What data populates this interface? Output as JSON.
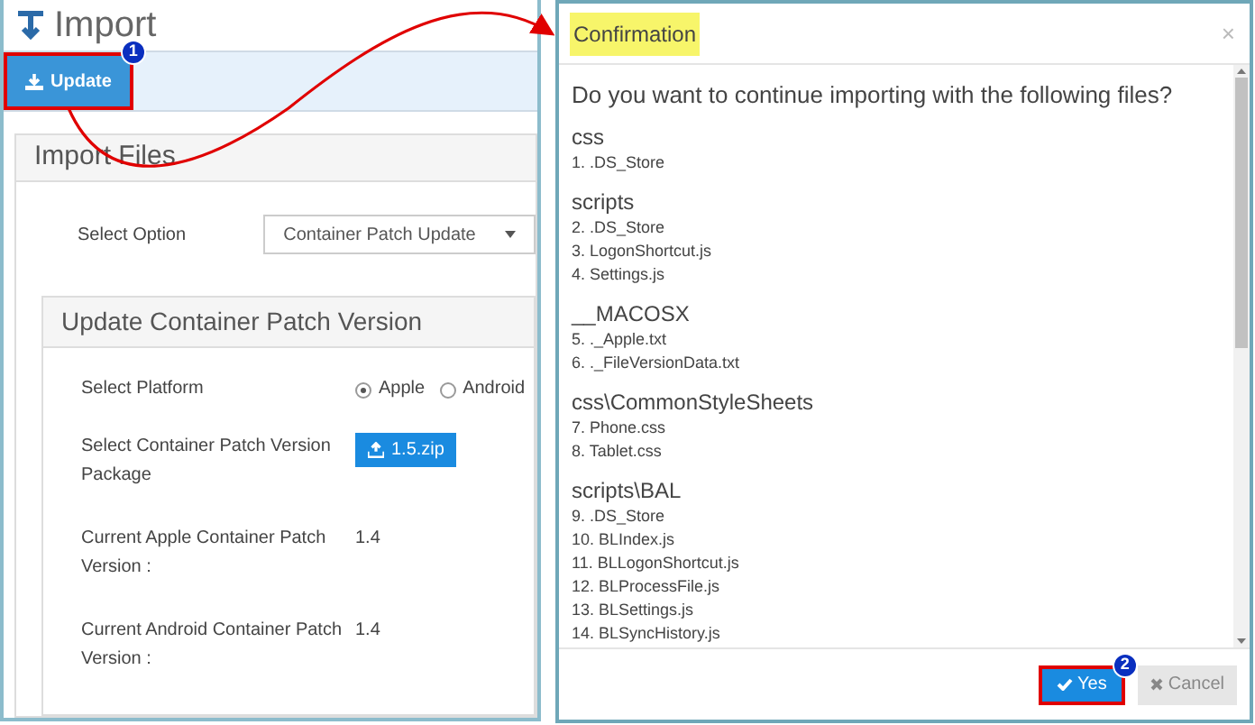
{
  "page": {
    "title": "Import"
  },
  "toolbar": {
    "update_button": "Update",
    "callout": "1"
  },
  "import_files": {
    "title": "Import Files",
    "select_option": {
      "label": "Select Option",
      "value": "Container Patch Update"
    },
    "update_panel": {
      "title": "Update Container Patch Version",
      "platform": {
        "label": "Select Platform",
        "options": [
          {
            "label": "Apple",
            "selected": true
          },
          {
            "label": "Android",
            "selected": false
          }
        ]
      },
      "package": {
        "label": "Select Container Patch Version Package",
        "button": "1.5.zip"
      },
      "versions": [
        {
          "label": "Current Apple Container Patch Version :",
          "value": "1.4"
        },
        {
          "label": "Current Android Container Patch Version :",
          "value": "1.4"
        }
      ]
    }
  },
  "dialog": {
    "title": "Confirmation",
    "close": "×",
    "question": "Do you want to continue importing with the following files?",
    "groups": [
      {
        "name": "css",
        "files": [
          "1. .DS_Store"
        ]
      },
      {
        "name": "scripts",
        "files": [
          "2. .DS_Store",
          "3. LogonShortcut.js",
          "4. Settings.js"
        ]
      },
      {
        "name": "__MACOSX",
        "files": [
          "5. ._Apple.txt",
          "6. ._FileVersionData.txt"
        ]
      },
      {
        "name": "css\\CommonStyleSheets",
        "files": [
          "7. Phone.css",
          "8. Tablet.css"
        ]
      },
      {
        "name": "scripts\\BAL",
        "files": [
          "9. .DS_Store",
          "10. BLIndex.js",
          "11. BLLogonShortcut.js",
          "12. BLProcessFile.js",
          "13. BLSettings.js",
          "14. BLSyncHistory.js"
        ]
      }
    ],
    "buttons": [
      {
        "label": "Yes",
        "kind": "primary",
        "callout": "2"
      },
      {
        "label": "Cancel",
        "kind": "secondary"
      }
    ]
  }
}
